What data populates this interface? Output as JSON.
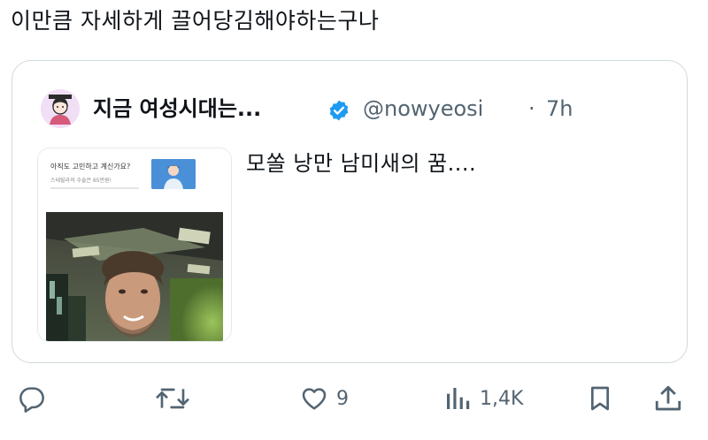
{
  "post": {
    "text": "이만큼 자세하게 끌어당김해야하는구나"
  },
  "quote": {
    "display_name": "지금 여성시대는...",
    "handle": "@nowyeosi",
    "separator": "·",
    "time": "7h",
    "body": "모쏠 낭만 남미새의 꿈....",
    "media": {
      "ad_title": "아직도 고민하고 계신가요?",
      "ad_subtitle": "스테릴라의 수술은 65만원!"
    }
  },
  "actions": {
    "reply_count": "",
    "repost_count": "",
    "like_count": "9",
    "view_count": "1,4K"
  },
  "colors": {
    "text": "#0f1419",
    "muted": "#536471",
    "verified": "#1d9bf0",
    "border": "#cfd9de"
  }
}
